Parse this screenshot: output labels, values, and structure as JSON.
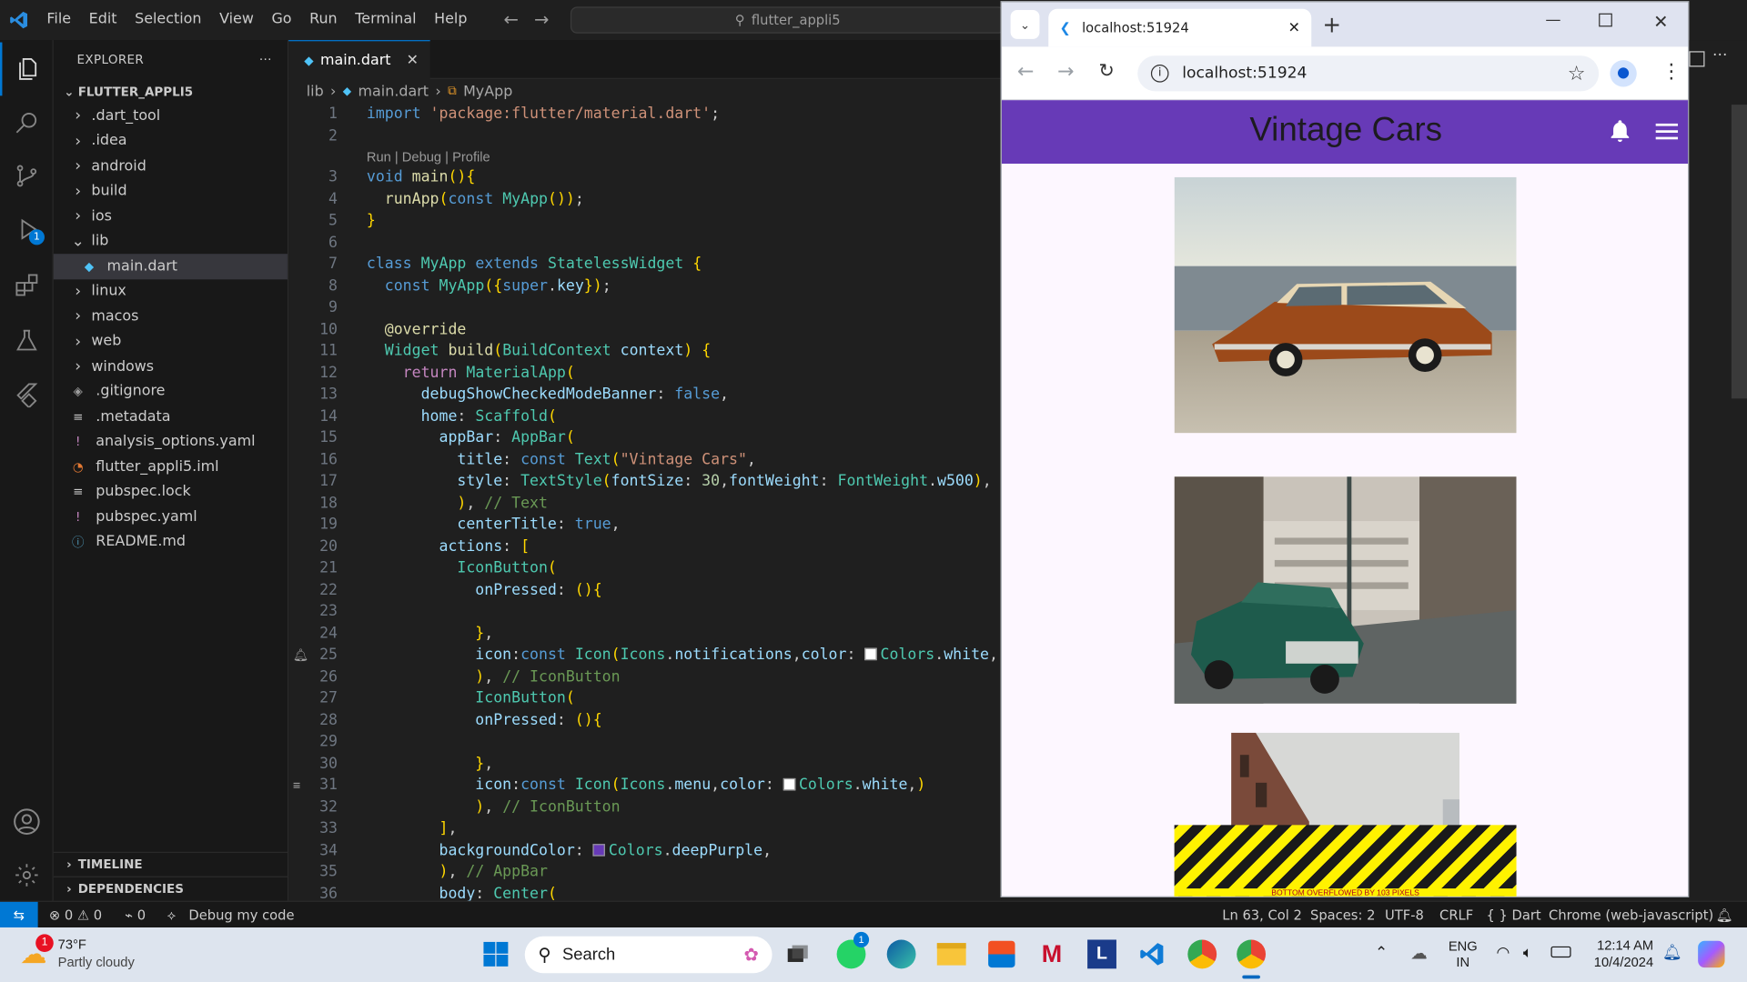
{
  "titlebar": {
    "menus": [
      "File",
      "Edit",
      "Selection",
      "View",
      "Go",
      "Run",
      "Terminal",
      "Help"
    ],
    "search_text": "flutter_appli5"
  },
  "sidebar": {
    "title": "EXPLORER",
    "project": "FLUTTER_APPLI5",
    "items": [
      {
        "label": ".dart_tool",
        "type": "folder",
        "icon": "chevron-right-icon"
      },
      {
        "label": ".idea",
        "type": "folder",
        "icon": "chevron-right-icon"
      },
      {
        "label": "android",
        "type": "folder",
        "icon": "chevron-right-icon"
      },
      {
        "label": "build",
        "type": "folder",
        "icon": "chevron-right-icon"
      },
      {
        "label": "ios",
        "type": "folder",
        "icon": "chevron-right-icon"
      },
      {
        "label": "lib",
        "type": "folder-open",
        "icon": "chevron-down-icon"
      },
      {
        "label": "main.dart",
        "type": "file",
        "icon": "dart-file-icon"
      },
      {
        "label": "linux",
        "type": "folder",
        "icon": "chevron-right-icon"
      },
      {
        "label": "macos",
        "type": "folder",
        "icon": "chevron-right-icon"
      },
      {
        "label": "web",
        "type": "folder",
        "icon": "chevron-right-icon"
      },
      {
        "label": "windows",
        "type": "folder",
        "icon": "chevron-right-icon"
      },
      {
        "label": ".gitignore",
        "type": "file",
        "icon": "git-file-icon"
      },
      {
        "label": ".metadata",
        "type": "file",
        "icon": "lines-file-icon"
      },
      {
        "label": "analysis_options.yaml",
        "type": "file",
        "icon": "yaml-file-icon"
      },
      {
        "label": "flutter_appli5.iml",
        "type": "file",
        "icon": "rss-file-icon"
      },
      {
        "label": "pubspec.lock",
        "type": "file",
        "icon": "lines-file-icon"
      },
      {
        "label": "pubspec.yaml",
        "type": "file",
        "icon": "yaml-file-icon"
      },
      {
        "label": "README.md",
        "type": "file",
        "icon": "info-file-icon"
      }
    ],
    "timeline": "TIMELINE",
    "dependencies": "DEPENDENCIES"
  },
  "editor": {
    "tab_label": "main.dart",
    "breadcrumb": [
      "lib",
      "main.dart",
      "MyApp"
    ],
    "codelens": "Run | Debug | Profile",
    "lines": [
      {
        "n": "1",
        "t": "import 'package:flutter/material.dart';"
      },
      {
        "n": "2",
        "t": ""
      },
      {
        "n": "3",
        "t": "void main(){"
      },
      {
        "n": "4",
        "t": "  runApp(const MyApp());"
      },
      {
        "n": "5",
        "t": "}"
      },
      {
        "n": "6",
        "t": ""
      },
      {
        "n": "7",
        "t": "class MyApp extends StatelessWidget {"
      },
      {
        "n": "8",
        "t": "  const MyApp({super.key});"
      },
      {
        "n": "9",
        "t": ""
      },
      {
        "n": "10",
        "t": "  @override"
      },
      {
        "n": "11",
        "t": "  Widget build(BuildContext context) {"
      },
      {
        "n": "12",
        "t": "    return MaterialApp("
      },
      {
        "n": "13",
        "t": "      debugShowCheckedModeBanner: false,"
      },
      {
        "n": "14",
        "t": "      home: Scaffold("
      },
      {
        "n": "15",
        "t": "        appBar: AppBar("
      },
      {
        "n": "16",
        "t": "          title: const Text(\"Vintage Cars\","
      },
      {
        "n": "17",
        "t": "          style: TextStyle(fontSize: 30,fontWeight: FontWeight.w500),"
      },
      {
        "n": "18",
        "t": "          ), // Text"
      },
      {
        "n": "19",
        "t": "          centerTitle: true,"
      },
      {
        "n": "20",
        "t": "        actions: ["
      },
      {
        "n": "21",
        "t": "          IconButton("
      },
      {
        "n": "22",
        "t": "            onPressed: (){"
      },
      {
        "n": "23",
        "t": ""
      },
      {
        "n": "24",
        "t": "            },"
      },
      {
        "n": "25",
        "t": "            icon:const Icon(Icons.notifications,color: Colors.white,)"
      },
      {
        "n": "26",
        "t": "            ), // IconButton"
      },
      {
        "n": "27",
        "t": "            IconButton("
      },
      {
        "n": "28",
        "t": "            onPressed: (){"
      },
      {
        "n": "29",
        "t": ""
      },
      {
        "n": "30",
        "t": "            },"
      },
      {
        "n": "31",
        "t": "            icon:const Icon(Icons.menu,color: Colors.white,)"
      },
      {
        "n": "32",
        "t": "            ), // IconButton"
      },
      {
        "n": "33",
        "t": "        ],"
      },
      {
        "n": "34",
        "t": "        backgroundColor: Colors.deepPurple,"
      },
      {
        "n": "35",
        "t": "        ), // AppBar"
      },
      {
        "n": "36",
        "t": "        body: Center("
      }
    ]
  },
  "browser": {
    "tab_title": "localhost:51924",
    "url": "localhost:51924",
    "app_title": "Vintage Cars",
    "appbar_color": "#673ab7",
    "overflow_message": "BOTTOM OVERFLOWED BY 103 PIXELS"
  },
  "statusbar": {
    "errors": "0",
    "warnings": "0",
    "ports": "0",
    "debug": "Debug my code",
    "position": "Ln 63, Col 2",
    "spaces": "Spaces: 2",
    "encoding": "UTF-8",
    "eol": "CRLF",
    "language": "Dart",
    "device": "Chrome (web-javascript)"
  },
  "taskbar": {
    "weather_temp": "73°F",
    "weather_desc": "Partly cloudy",
    "weather_badge": "1",
    "search_label": "Search",
    "whatsapp_badge": "1",
    "lang_top": "ENG",
    "lang_bottom": "IN",
    "time": "12:14 AM",
    "date": "10/4/2024"
  }
}
